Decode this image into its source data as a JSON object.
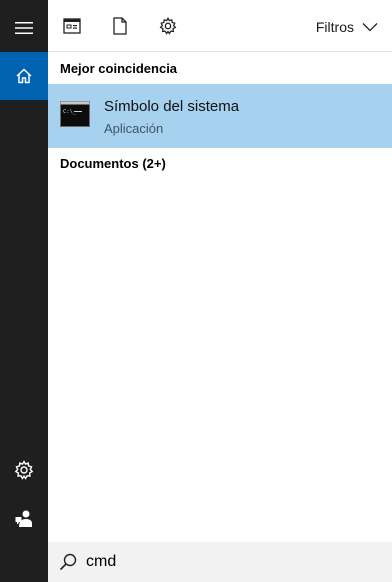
{
  "rail": {
    "items": [
      {
        "icon": "hamburger-menu-icon"
      },
      {
        "icon": "home-icon",
        "active": true
      },
      {
        "icon": "settings-gear-icon"
      },
      {
        "icon": "user-feedback-icon"
      }
    ]
  },
  "toolbar": {
    "icons": [
      "apps-icon",
      "documents-icon",
      "settings-gear-icon"
    ],
    "filters_label": "Filtros"
  },
  "sections": {
    "best_match_title": "Mejor coincidencia",
    "documents_title": "Documentos (2+)"
  },
  "result": {
    "name": "Símbolo del sistema",
    "type": "Aplicación",
    "icon": "command-prompt-icon"
  },
  "search": {
    "value": "cmd",
    "icon": "search-icon"
  },
  "colors": {
    "rail_background": "#1f1f1f",
    "rail_active": "#0063b1",
    "result_highlight": "#a6d2f0",
    "search_background": "#f2f2f2"
  }
}
